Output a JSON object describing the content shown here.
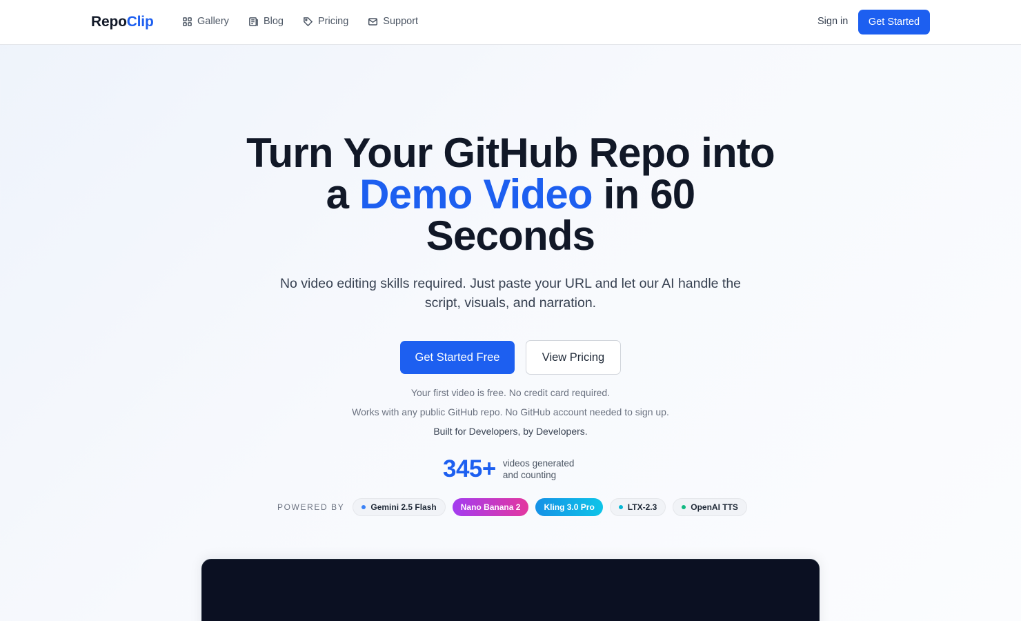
{
  "brand": {
    "part1": "Repo",
    "part2": "Clip",
    "accent_color": "#1d5ff0"
  },
  "nav": {
    "items": [
      {
        "label": "Gallery",
        "icon": "grid-icon"
      },
      {
        "label": "Blog",
        "icon": "newspaper-icon"
      },
      {
        "label": "Pricing",
        "icon": "tag-icon"
      },
      {
        "label": "Support",
        "icon": "mail-icon"
      }
    ],
    "sign_in": "Sign in",
    "get_started": "Get Started"
  },
  "hero": {
    "line1": "Turn Your GitHub Repo into",
    "line2_prefix": "a ",
    "line2_accent": "Demo Video",
    "line2_suffix": " in 60",
    "line3": "Seconds",
    "subtitle": "No video editing skills required. Just paste your URL and let our AI handle the script, visuals, and narration.",
    "cta_primary": "Get Started Free",
    "cta_secondary": "View Pricing",
    "note1": "Your first video is free. No credit card required.",
    "note2": "Works with any public GitHub repo. No GitHub account needed to sign up.",
    "note3": "Built for Developers, by Developers."
  },
  "stats": {
    "number": "345+",
    "line1": "videos generated",
    "line2": "and counting"
  },
  "powered_by": {
    "label": "POWERED BY",
    "chips": [
      {
        "label": "Gemini 2.5 Flash",
        "dot_color": "#3b82f6"
      },
      {
        "label": "Nano Banana 2"
      },
      {
        "label": "Kling 3.0 Pro"
      },
      {
        "label": "LTX-2.3",
        "dot_color": "#06b6d4"
      },
      {
        "label": "OpenAI TTS",
        "dot_color": "#10b981"
      }
    ]
  },
  "colors": {
    "primary": "#1d5ff0",
    "dark": "#111827",
    "video_bg": "#0b1022"
  }
}
